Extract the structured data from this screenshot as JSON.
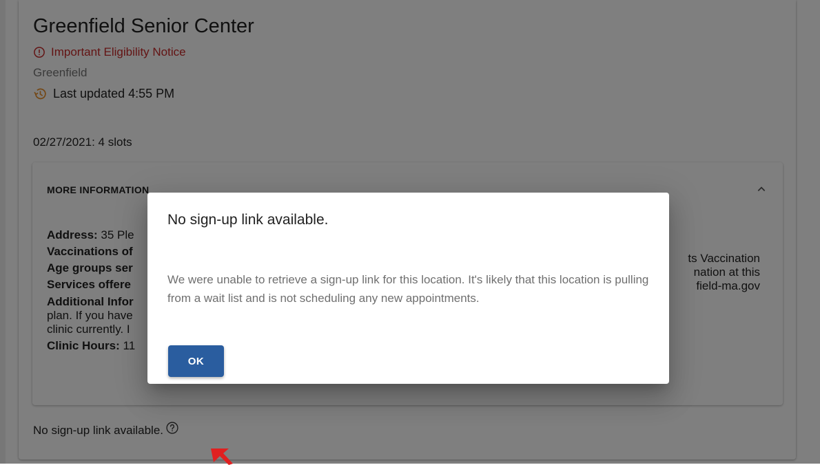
{
  "location": {
    "title": "Greenfield Senior Center",
    "notice": "Important Eligibility Notice",
    "city": "Greenfield",
    "last_updated": "Last updated 4:55 PM",
    "slots": "02/27/2021: 4 slots"
  },
  "more_info": {
    "header": "MORE INFORMATION",
    "address_label": "Address:",
    "address_value": " 35 Ple",
    "vaccinations_label": "Vaccinations of",
    "age_groups_label": "Age groups ser",
    "services_label": "Services offere",
    "additional_label": "Additional Infor",
    "additional_line2": "plan. If you have",
    "additional_line3": "clinic currently. I",
    "additional_right1": "ts Vaccination",
    "additional_right2": "nation at this",
    "additional_right3": "field-ma.gov",
    "hours_label": "Clinic Hours:",
    "hours_value": " 11"
  },
  "signup": {
    "text": "No sign-up link available."
  },
  "dialog": {
    "title": "No sign-up link available.",
    "body": "We were unable to retrieve a sign-up link for this location. It's likely that this location is pulling from a wait list and is not scheduling any new appointments.",
    "ok_label": "OK"
  },
  "colors": {
    "notice": "#c62828",
    "history_icon": "#e8912d",
    "primary_button": "#2a5d9f",
    "cursor": "#e02020"
  },
  "icons": {
    "notice": "error-outline-icon",
    "updated": "history-icon",
    "panel_toggle": "chevron-up-icon",
    "help": "help-outline-icon",
    "cursor": "mouse-pointer-icon"
  }
}
